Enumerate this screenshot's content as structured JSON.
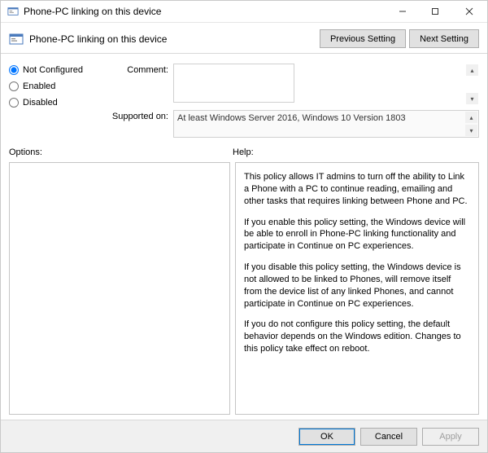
{
  "titlebar": {
    "title": "Phone-PC linking on this device"
  },
  "header": {
    "title": "Phone-PC linking on this device",
    "prev_btn": "Previous Setting",
    "next_btn": "Next Setting"
  },
  "radio": {
    "not_configured": "Not Configured",
    "enabled": "Enabled",
    "disabled": "Disabled",
    "selected": "not_configured"
  },
  "fields": {
    "comment_label": "Comment:",
    "comment_value": "",
    "supported_label": "Supported on:",
    "supported_value": "At least Windows Server 2016, Windows 10 Version 1803"
  },
  "labels": {
    "options": "Options:",
    "help": "Help:"
  },
  "help": {
    "p1": "This policy allows IT admins to turn off the ability to Link a Phone with a PC to continue reading, emailing and other tasks that requires linking between Phone and PC.",
    "p2": "If you enable this policy setting, the Windows device will be able to enroll in Phone-PC linking functionality and participate in Continue on PC experiences.",
    "p3": "If you disable this policy setting, the Windows device is not allowed to be linked to Phones, will remove itself from the device list of any linked Phones, and cannot participate in Continue on PC experiences.",
    "p4": "If you do not configure this policy setting, the default behavior depends on the Windows edition. Changes to this policy take effect on reboot."
  },
  "buttons": {
    "ok": "OK",
    "cancel": "Cancel",
    "apply": "Apply"
  }
}
